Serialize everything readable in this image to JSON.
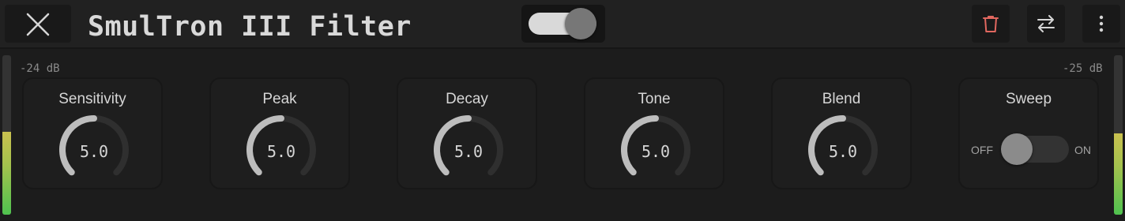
{
  "header": {
    "title": "SmulTron III Filter",
    "power_on": true
  },
  "meters": {
    "left": {
      "label": "-24 dB",
      "level": 0.52
    },
    "right": {
      "label": "-25 dB",
      "level": 0.51
    }
  },
  "controls": [
    {
      "label": "Sensitivity",
      "value": "5.0",
      "fraction": 0.5
    },
    {
      "label": "Peak",
      "value": "5.0",
      "fraction": 0.5
    },
    {
      "label": "Decay",
      "value": "5.0",
      "fraction": 0.5
    },
    {
      "label": "Tone",
      "value": "5.0",
      "fraction": 0.5
    },
    {
      "label": "Blend",
      "value": "5.0",
      "fraction": 0.5
    }
  ],
  "sweep": {
    "label": "Sweep",
    "off_label": "OFF",
    "on_label": "ON",
    "state": "off"
  },
  "colors": {
    "accent_meter": "#4fc24f",
    "delete_icon": "#e0675f",
    "knob_arc": "#bdbdbd",
    "knob_track": "#2f2f2f"
  },
  "icons": {
    "close": "close-icon",
    "delete": "trash-icon",
    "swap": "swap-arrows-icon",
    "menu": "more-vertical-icon"
  }
}
